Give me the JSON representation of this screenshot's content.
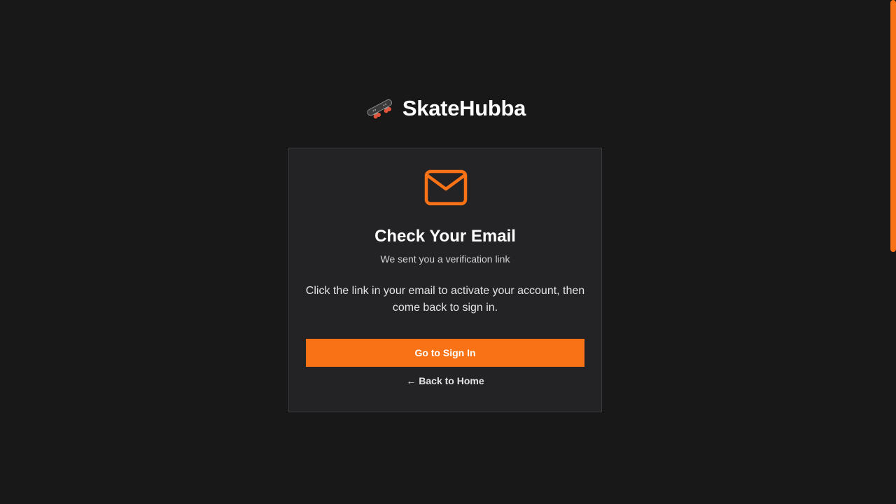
{
  "brand": {
    "name": "SkateHubba",
    "logo_icon": "skateboard-icon"
  },
  "card": {
    "icon": "mail-icon",
    "title": "Check Your Email",
    "subtitle": "We sent you a verification link",
    "body": "Click the link in your email to activate your account, then come back to sign in.",
    "primary_button_label": "Go to Sign In",
    "back_link_label": "← Back to Home"
  },
  "colors": {
    "background": "#181818",
    "card": "#232325",
    "accent": "#f97316"
  }
}
